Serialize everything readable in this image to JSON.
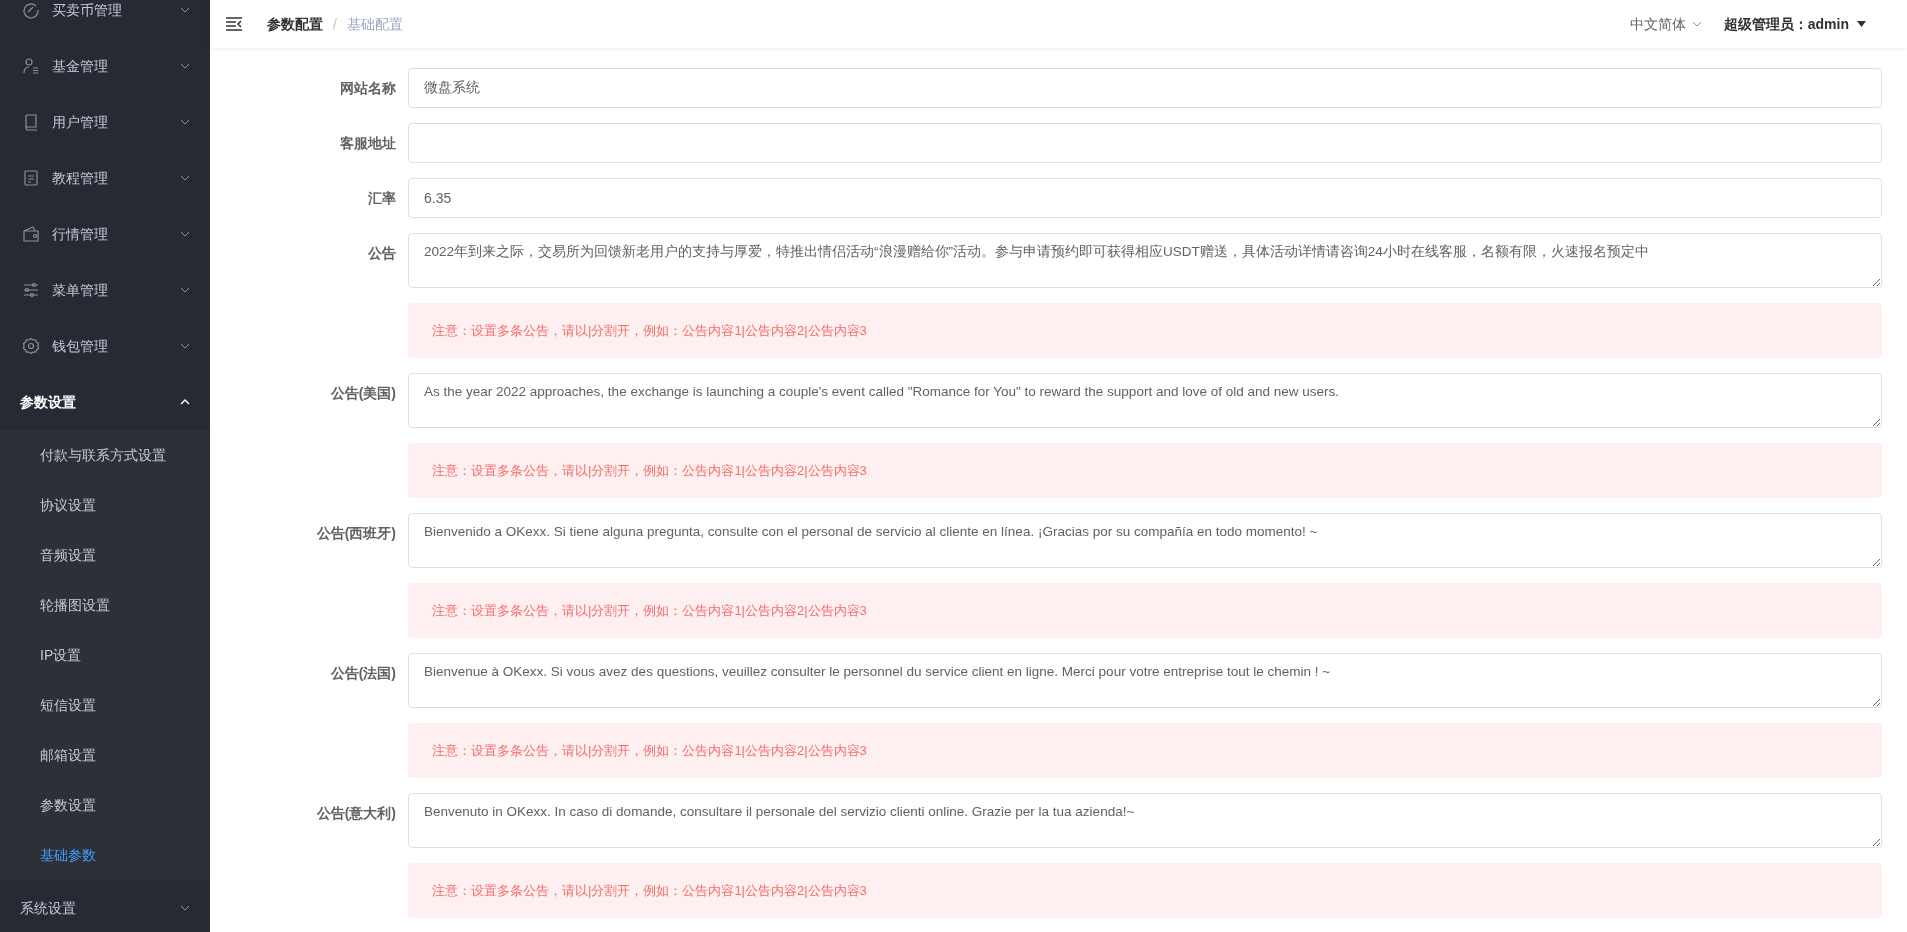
{
  "sidebar": {
    "items": [
      {
        "label": "买卖币管理",
        "expanded": false
      },
      {
        "label": "基金管理",
        "expanded": false
      },
      {
        "label": "用户管理",
        "expanded": false
      },
      {
        "label": "教程管理",
        "expanded": false
      },
      {
        "label": "行情管理",
        "expanded": false
      },
      {
        "label": "菜单管理",
        "expanded": false
      },
      {
        "label": "钱包管理",
        "expanded": false
      },
      {
        "label": "参数设置",
        "expanded": true,
        "children": [
          {
            "label": "付款与联系方式设置",
            "selected": false
          },
          {
            "label": "协议设置",
            "selected": false
          },
          {
            "label": "音频设置",
            "selected": false
          },
          {
            "label": "轮播图设置",
            "selected": false
          },
          {
            "label": "IP设置",
            "selected": false
          },
          {
            "label": "短信设置",
            "selected": false
          },
          {
            "label": "邮箱设置",
            "selected": false
          },
          {
            "label": "参数设置",
            "selected": false
          },
          {
            "label": "基础参数",
            "selected": true
          }
        ]
      },
      {
        "label": "系统设置",
        "expanded": false
      }
    ]
  },
  "header": {
    "breadcrumb": [
      "参数配置",
      "基础配置"
    ],
    "separator": "/",
    "language": "中文简体",
    "user": "超级管理员：admin"
  },
  "form": {
    "fields": [
      {
        "label": "网站名称",
        "kind": "input",
        "value": "微盘系统"
      },
      {
        "label": "客服地址",
        "kind": "input"
      },
      {
        "label": "汇率",
        "kind": "input",
        "value": "6.35"
      },
      {
        "label": "公告",
        "kind": "textarea",
        "value": "2022年到来之际，交易所为回馈新老用户的支持与厚爱，特推出情侣活动“浪漫赠给你”活动。参与申请预约即可获得相应USDT赠送，具体活动详情请咨询24小时在线客服，名额有限，火速报名预定中",
        "note": "注意：设置多条公告，请以|分割开，例如：公告内容1|公告内容2|公告内容3"
      },
      {
        "label": "公告(美国)",
        "kind": "textarea",
        "value": "As the year 2022 approaches, the exchange is launching a couple's event called \"Romance for You\" to reward the support and love of old and new users.",
        "note": "注意：设置多条公告，请以|分割开，例如：公告内容1|公告内容2|公告内容3"
      },
      {
        "label": "公告(西班牙)",
        "kind": "textarea",
        "value": "Bienvenido a OKexx. Si tiene alguna pregunta, consulte con el personal de servicio al cliente en línea. ¡Gracias por su compañía en todo momento! ~",
        "note": "注意：设置多条公告，请以|分割开，例如：公告内容1|公告内容2|公告内容3"
      },
      {
        "label": "公告(法国)",
        "kind": "textarea",
        "value": "Bienvenue à OKexx. Si vous avez des questions, veuillez consulter le personnel du service client en ligne. Merci pour votre entreprise tout le chemin ! ~",
        "note": "注意：设置多条公告，请以|分割开，例如：公告内容1|公告内容2|公告内容3"
      },
      {
        "label": "公告(意大利)",
        "kind": "textarea",
        "value": "Benvenuto in OKexx. In caso di domande, consultare il personale del servizio clienti online. Grazie per la tua azienda!~",
        "note": "注意：设置多条公告，请以|分割开，例如：公告内容1|公告内容2|公告内容3"
      }
    ]
  }
}
